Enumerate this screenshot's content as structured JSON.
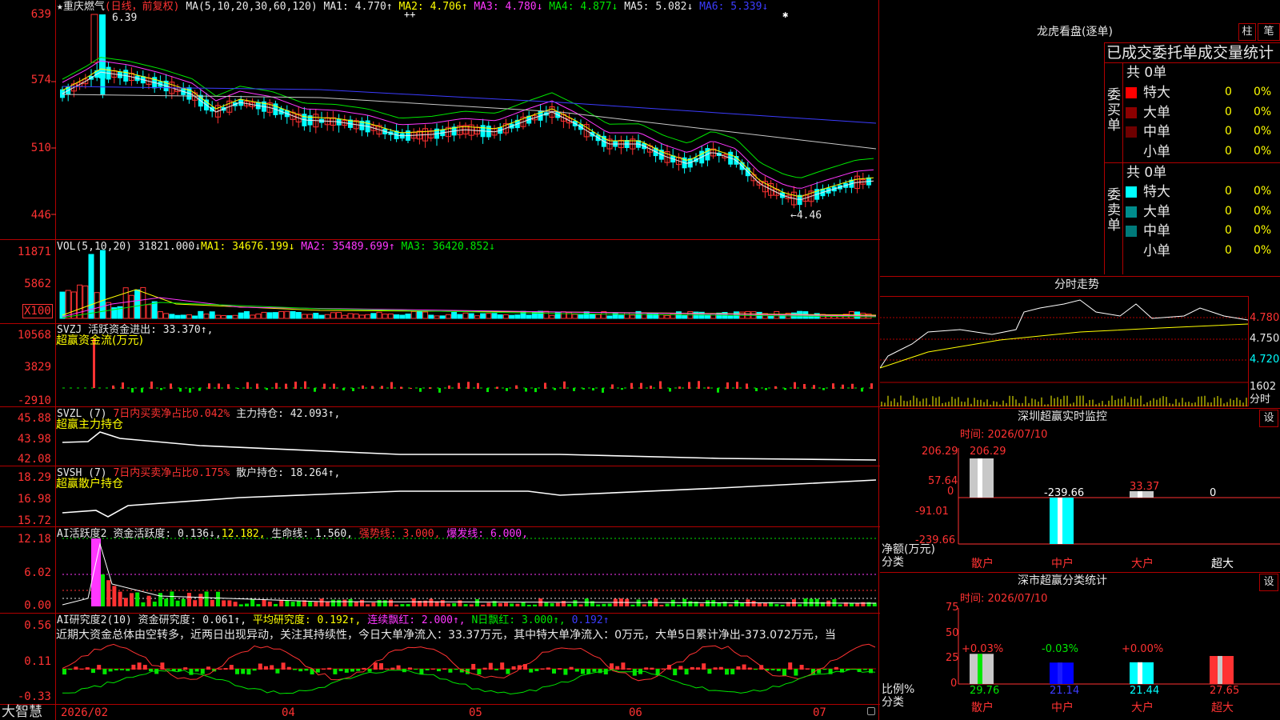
{
  "stock": {
    "title": "★重庆燃气",
    "period": "(日线，前复权)",
    "ma_head": "MA(5,10,20,30,60,120)",
    "ma1": "MA1: 4.770↑",
    "ma2": "MA2: 4.706↑",
    "ma3": "MA3: 4.780↓",
    "ma4": "MA4: 4.877↓",
    "ma5": "MA5: 5.082↓",
    "ma6": "MA6: 5.339↓",
    "high_mark": "6.39",
    "low_mark": "←4.46",
    "yaxis": [
      "639",
      "574",
      "510",
      "446"
    ]
  },
  "volume": {
    "head": "VOL(5,10,20)",
    "val": "31821.000↓",
    "ma1": "MA1: 34676.199↓",
    "ma2": "MA2: 35489.699↑",
    "ma3": "MA3: 36420.852↓",
    "yaxis": [
      "11871",
      "5862"
    ],
    "unit": "X100"
  },
  "svzj": {
    "head": "SVZJ",
    "text": "活跃资金进出: 33.370↑,",
    "sub": "超赢资金流(万元)",
    "yaxis": [
      "10568",
      "3829",
      "-2910"
    ]
  },
  "svzl": {
    "head": "SVZL (7)",
    "t1": "7日内买卖净占比0.042%",
    "t2": "主力持仓: 42.093↑,",
    "sub": "超赢主力持仓",
    "yaxis": [
      "45.88",
      "43.98",
      "42.08"
    ]
  },
  "svsh": {
    "head": "SVSH (7)",
    "t1": "7日内买卖净占比0.175%",
    "t2": "散户持仓: 18.264↑,",
    "sub": "超赢散户持仓",
    "yaxis": [
      "18.29",
      "16.98",
      "15.72"
    ]
  },
  "ai_act": {
    "head": "AI活跃度2",
    "t1": "资金活跃度: 0.136↓,",
    "t2": "12.182,",
    "t3": "生命线: 1.560,",
    "t4": "强势线: 3.000,",
    "t5": "爆发线: 6.000,",
    "yaxis": [
      "12.18",
      "6.02",
      "0.00"
    ]
  },
  "ai_res": {
    "head": "AI研究度2(10)",
    "t1": "资金研究度: 0.061↑,",
    "t2": "平均研究度: 0.192↑,",
    "t3": "连续飘红: 2.000↑,",
    "t4": "N日飘红: 3.000↑,",
    "t5": "0.192↑",
    "comment": "近期大资金总体由空转多，近两日出现异动，关注其持续性，今日大单净流入：33.37万元，其中特大单净流入：0万元，大单5日累计净出-373.072万元，当",
    "yaxis": [
      "0.56",
      "0.11",
      "-0.33"
    ]
  },
  "bottom": {
    "logo": "大智慧",
    "dates": [
      "2026/02",
      "04",
      "05",
      "06",
      "07"
    ]
  },
  "dragon": {
    "title": "龙虎看盘(逐单)",
    "btn1": "柱",
    "btn2": "笔",
    "header": "已成交委托单成交量统计",
    "buy_label": "委买单",
    "sell_label": "委卖单",
    "buy_total": "共 0单",
    "sell_total": "共 0单",
    "buy_rows": [
      {
        "label": "特大",
        "val": "0",
        "pct": "0%",
        "color": "#ff0000"
      },
      {
        "label": "大单",
        "val": "0",
        "pct": "0%",
        "color": "#8c0000"
      },
      {
        "label": "中单",
        "val": "0",
        "pct": "0%",
        "color": "#6e0000"
      },
      {
        "label": "小单",
        "val": "0",
        "pct": "0%",
        "color": "#000000"
      }
    ],
    "sell_rows": [
      {
        "label": "特大",
        "val": "0",
        "pct": "0%",
        "color": "#00ffff"
      },
      {
        "label": "大单",
        "val": "0",
        "pct": "0%",
        "color": "#008c8c"
      },
      {
        "label": "中单",
        "val": "0",
        "pct": "0%",
        "color": "#007a7a"
      },
      {
        "label": "小单",
        "val": "0",
        "pct": "0%",
        "color": "#000000"
      }
    ]
  },
  "intraday": {
    "title": "分时走势",
    "yaxis": [
      "4.780",
      "4.750",
      "4.720"
    ],
    "vol_label": "1602",
    "vol_unit": "分时"
  },
  "monitor": {
    "title": "深圳超赢实时监控",
    "set": "设",
    "time": "时间: 2026/07/10",
    "yaxis": [
      "206.29",
      "57.64",
      "0",
      "-91.01",
      "-239.66"
    ],
    "xaxis_label1": "净额(万元)",
    "xaxis_label2": "分类",
    "cats": [
      "散户",
      "中户",
      "大户",
      "超大"
    ],
    "values": [
      "206.29",
      "-239.66",
      "33.37",
      "0"
    ]
  },
  "classify": {
    "title": "深市超赢分类统计",
    "set": "设",
    "time": "时间: 2026/07/10",
    "yaxis": [
      "75",
      "50",
      "25",
      "0"
    ],
    "xaxis_label1": "比例%",
    "xaxis_label2": "分类",
    "cats": [
      "散户",
      "中户",
      "大户",
      "超大"
    ],
    "changes": [
      "+0.03%",
      "-0.03%",
      "+0.00%",
      ""
    ],
    "values": [
      "29.76",
      "21.14",
      "21.44",
      "27.65"
    ]
  },
  "colors": {
    "up": "#ff3232",
    "down": "#00ffff",
    "grid": "#b00000"
  }
}
